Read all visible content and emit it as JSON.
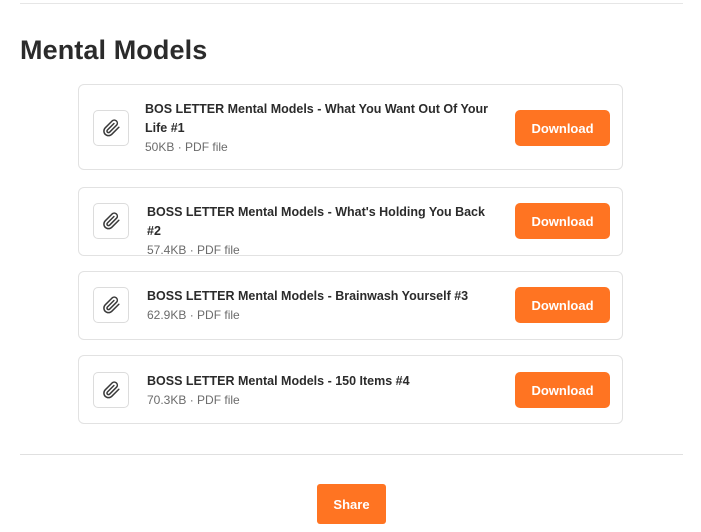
{
  "section": {
    "title": "Mental Models"
  },
  "files": [
    {
      "name": "BOS LETTER Mental Models - What You Want Out Of Your Life #1",
      "size": "50KB",
      "type": "PDF file",
      "meta": "50KB · PDF file",
      "action_label": "Download",
      "icon": "paperclip-icon"
    },
    {
      "name": "BOSS LETTER Mental Models - What's Holding You Back #2",
      "size": "57.4KB",
      "type": "PDF file",
      "meta": "57.4KB · PDF file",
      "action_label": "Download",
      "icon": "paperclip-icon"
    },
    {
      "name": "BOSS LETTER Mental Models - Brainwash Yourself #3",
      "size": "62.9KB",
      "type": "PDF file",
      "meta": "62.9KB · PDF file",
      "action_label": "Download",
      "icon": "paperclip-icon"
    },
    {
      "name": "BOSS LETTER Mental Models - 150 Items #4",
      "size": "70.3KB",
      "type": "PDF file",
      "meta": "70.3KB · PDF file",
      "action_label": "Download",
      "icon": "paperclip-icon"
    }
  ],
  "footer": {
    "share_label": "Share"
  },
  "colors": {
    "accent": "#ff7422",
    "text": "#2b2b2b",
    "muted_text": "#6b6b6b",
    "border": "#e2e2e2"
  }
}
